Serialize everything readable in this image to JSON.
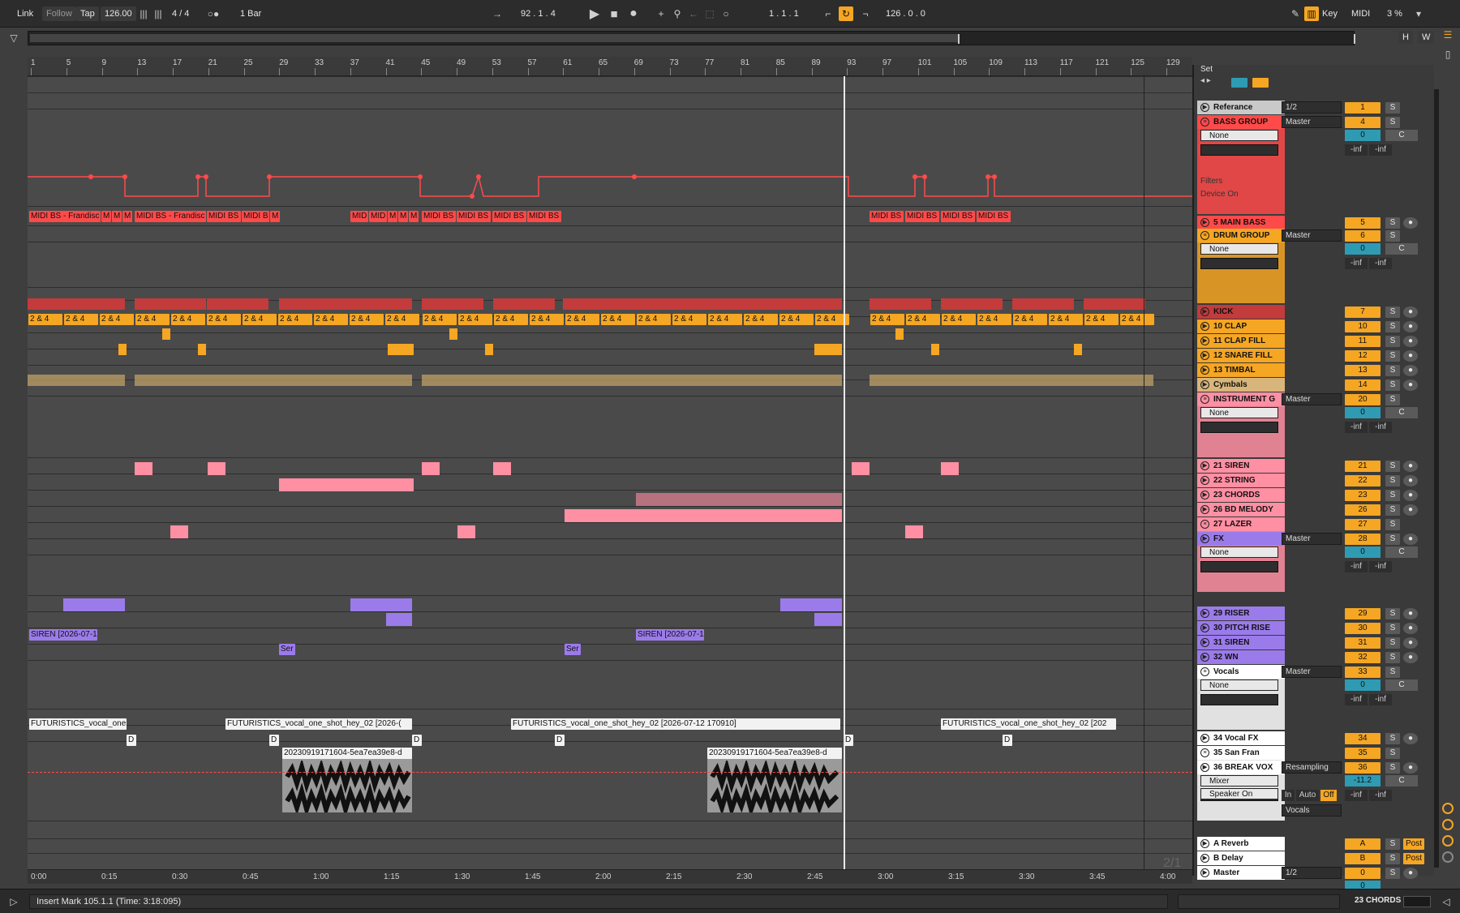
{
  "topbar": {
    "link": "Link",
    "follow": "Follow",
    "tap": "Tap",
    "tempo": "126.00",
    "signature": "4 / 4",
    "quantize": "1 Bar",
    "position": "92 .  1 .  4",
    "loop_start": "1 .  1 .  1",
    "loop_length": "126 .  0 .  0",
    "key": "Key",
    "midi": "MIDI",
    "cpu": "3 %",
    "hw_h": "H",
    "hw_w": "W"
  },
  "ruler": {
    "bars": [
      "1",
      "5",
      "9",
      "13",
      "17",
      "21",
      "25",
      "29",
      "33",
      "37",
      "41",
      "45",
      "49",
      "53",
      "57",
      "61",
      "65",
      "69",
      "73",
      "77",
      "81",
      "85",
      "89",
      "93",
      "97",
      "101",
      "105",
      "109",
      "113",
      "117",
      "121",
      "125",
      "129"
    ]
  },
  "timeline": {
    "times": [
      "0:00",
      "0:15",
      "0:30",
      "0:45",
      "1:00",
      "1:15",
      "1:30",
      "1:45",
      "2:00",
      "2:15",
      "2:30",
      "2:45",
      "3:00",
      "3:15",
      "3:30",
      "3:45",
      "4:00"
    ]
  },
  "clips": {
    "bass1": "MIDI BS - Frandisc",
    "bass_m1": "M",
    "bass_m2": "M",
    "bass_m3": "M",
    "bass2": "MIDI BS - Frandisc",
    "bass3": "MIDI BS",
    "bass4": "MIDI B",
    "bass_m4": "M",
    "bass5": "MID",
    "bass6": "MID",
    "bass_m5": "M",
    "bass_m6": "M",
    "bass_m7": "M",
    "bass7": "MIDI BS",
    "bass8": "MIDI BS",
    "bass9": "MIDI BS",
    "bass10": "MIDI BS",
    "bass11": "MIDI BS",
    "bass12": "MIDI BS",
    "bass13": "MIDI BS",
    "bass14": "MIDI BS",
    "clap": "2 & 4",
    "siren1": "SIREN [2026-07-1",
    "siren2": "SIREN [2026-07-1",
    "ser1": "Ser",
    "ser2": "Ser",
    "vox1": "FUTURISTICS_vocal_one",
    "vox2": "FUTURISTICS_vocal_one_shot_hey_02 [2026-(",
    "vox3": "FUTURISTICS_vocal_one_shot_hey_02 [2026-07-12 170910]",
    "vox4": "FUTURISTICS_vocal_one_shot_hey_02 [202",
    "sf": "D",
    "break1": "20230919171604-5ea7ea39e8-d",
    "break2": "20230919171604-5ea7ea39e8-d"
  },
  "set_label": "Set",
  "tracks": [
    {
      "name": "Referance",
      "routing": "1/2",
      "num": "1",
      "color": "#c9c9c9"
    },
    {
      "name": "BASS GROUP",
      "routing": "Master",
      "num": "4",
      "color": "#ff4a4a",
      "sub": "None",
      "vol": "0",
      "inf_l": "-inf",
      "inf_r": "-inf",
      "filters": "Filters",
      "device": "Device On"
    },
    {
      "name": "5 MAIN BASS",
      "num": "5",
      "color": "#ff4a4a"
    },
    {
      "name": "DRUM GROUP",
      "routing": "Master",
      "num": "6",
      "color": "#f5a623",
      "sub": "None",
      "vol": "0",
      "inf_l": "-inf",
      "inf_r": "-inf"
    },
    {
      "name": "KICK",
      "num": "7",
      "color": "#c33b3b"
    },
    {
      "name": "10 CLAP",
      "num": "10",
      "color": "#f5a623"
    },
    {
      "name": "11 CLAP FILL",
      "num": "11",
      "color": "#f5a623"
    },
    {
      "name": "12 SNARE FILL",
      "num": "12",
      "color": "#f5a623"
    },
    {
      "name": "13 TIMBAL",
      "num": "13",
      "color": "#f5a623"
    },
    {
      "name": "Cymbals",
      "num": "14",
      "color": "#d8b67b"
    },
    {
      "name": "INSTRUMENT G",
      "routing": "Master",
      "num": "20",
      "color": "#ff8fa3",
      "sub": "None",
      "vol": "0",
      "inf_l": "-inf",
      "inf_r": "-inf"
    },
    {
      "name": "21 SIREN",
      "num": "21",
      "color": "#ff8fa3"
    },
    {
      "name": "22 STRING",
      "num": "22",
      "color": "#ff8fa3"
    },
    {
      "name": "23 CHORDS",
      "num": "23",
      "color": "#ff8fa3"
    },
    {
      "name": "26 BD MELODY",
      "num": "26",
      "color": "#ff8fa3"
    },
    {
      "name": "27 LAZER",
      "num": "27",
      "color": "#ff8fa3"
    },
    {
      "name": "FX",
      "routing": "Master",
      "num": "28",
      "color": "#9b7bea",
      "sub": "None",
      "vol": "0",
      "inf_l": "-inf",
      "inf_r": "-inf"
    },
    {
      "name": "29 RISER",
      "num": "29",
      "color": "#9b7bea"
    },
    {
      "name": "30 PITCH RISE",
      "num": "30",
      "color": "#9b7bea"
    },
    {
      "name": "31 SIREN",
      "num": "31",
      "color": "#9b7bea"
    },
    {
      "name": "32 WN",
      "num": "32",
      "color": "#9b7bea"
    },
    {
      "name": "Vocals",
      "routing": "Master",
      "num": "33",
      "color": "#ffffff",
      "sub": "None",
      "vol": "0",
      "inf_l": "-inf",
      "inf_r": "-inf"
    },
    {
      "name": "34 Vocal FX",
      "num": "34",
      "color": "#ffffff"
    },
    {
      "name": "35 San Fran",
      "num": "35",
      "color": "#ffffff"
    },
    {
      "name": "36 BREAK VOX",
      "routing": "Resampling",
      "num": "36",
      "color": "#ffffff",
      "sub": "Mixer",
      "sub2": "Speaker On",
      "vol": "-11.2",
      "in": "In",
      "auto": "Auto",
      "off": "Off",
      "group_out": "Vocals",
      "inf_l": "-inf",
      "inf_r": "-inf"
    },
    {
      "name": "A Reverb",
      "num": "A",
      "color": "#ffffff",
      "post": "Post"
    },
    {
      "name": "B Delay",
      "num": "B",
      "color": "#ffffff",
      "post": "Post"
    },
    {
      "name": "Master",
      "routing": "1/2",
      "num": "0",
      "color": "#ffffff",
      "vol": "0"
    }
  ],
  "btn": {
    "s": "S",
    "c": "C"
  },
  "status": {
    "message": "Insert Mark 105.1.1 (Time: 3:18:095)",
    "selected": "23 CHORDS",
    "page": "2/1"
  }
}
